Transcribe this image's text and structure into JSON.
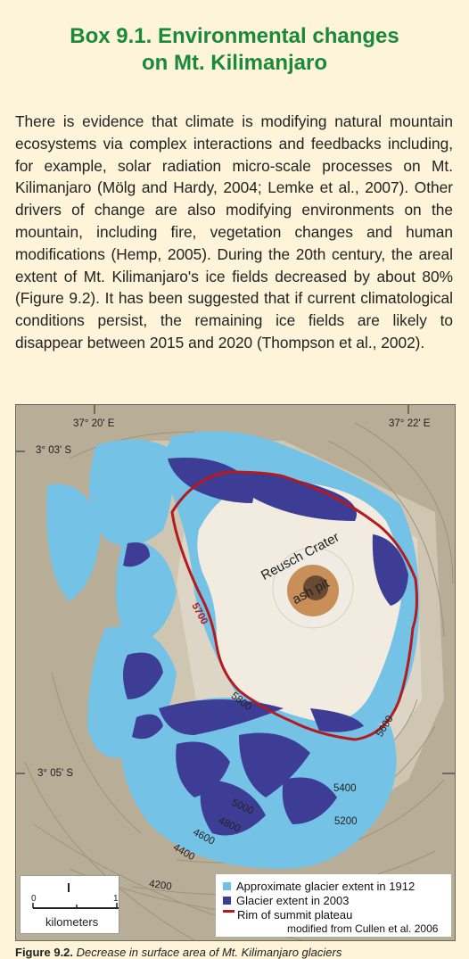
{
  "box": {
    "title_line1": "Box 9.1. Environmental changes",
    "title_line2": "on Mt. Kilimanjaro",
    "paragraph": "There is evidence that climate is modifying natural mountain ecosystems via complex interactions and feedbacks including, for example, solar radiation micro-scale processes on Mt. Kilimanjaro (Mölg and Hardy, 2004; Lemke et al., 2007). Other drivers of change are also modifying environments on the mountain, including fire, vegetation changes and human modifications (Hemp, 2005). During the 20th century, the areal extent of Mt. Kilimanjaro's ice fields decreased by about 80% (Figure 9.2). It has been suggested that if current climatological conditions persist, the remaining ice fields are likely to disappear between 2015 and 2020 (Thompson et al., 2002)."
  },
  "map": {
    "coords": {
      "lon_left": "37° 20' E",
      "lon_right": "37° 22' E",
      "lat_top": "3° 03' S",
      "lat_bottom": "3° 05' S"
    },
    "features": {
      "crater": "Reusch Crater",
      "pit": "ash pit"
    },
    "contours": {
      "c5700": "5700",
      "c5800": "5800",
      "c5600": "5600",
      "c5400": "5400",
      "c5200": "5200",
      "c5000": "5000",
      "c4800": "4800",
      "c4600": "4600",
      "c4400": "4400",
      "c4200": "4200"
    },
    "scale": {
      "zero": "0",
      "one": "1",
      "unit": "kilometers"
    },
    "legend": {
      "items": [
        {
          "label": "Approximate glacier extent in 1912",
          "color": "#6ec0e4"
        },
        {
          "label": "Glacier extent in 2003",
          "color": "#3d3c94"
        },
        {
          "label": "Rim of summit plateau",
          "color": "#b4191f"
        }
      ],
      "credit": "modified from Cullen et al. 2006"
    }
  },
  "caption": {
    "label": "Figure 9.2.",
    "text": "Decrease in surface area of Mt. Kilimanjaro glaciers"
  }
}
